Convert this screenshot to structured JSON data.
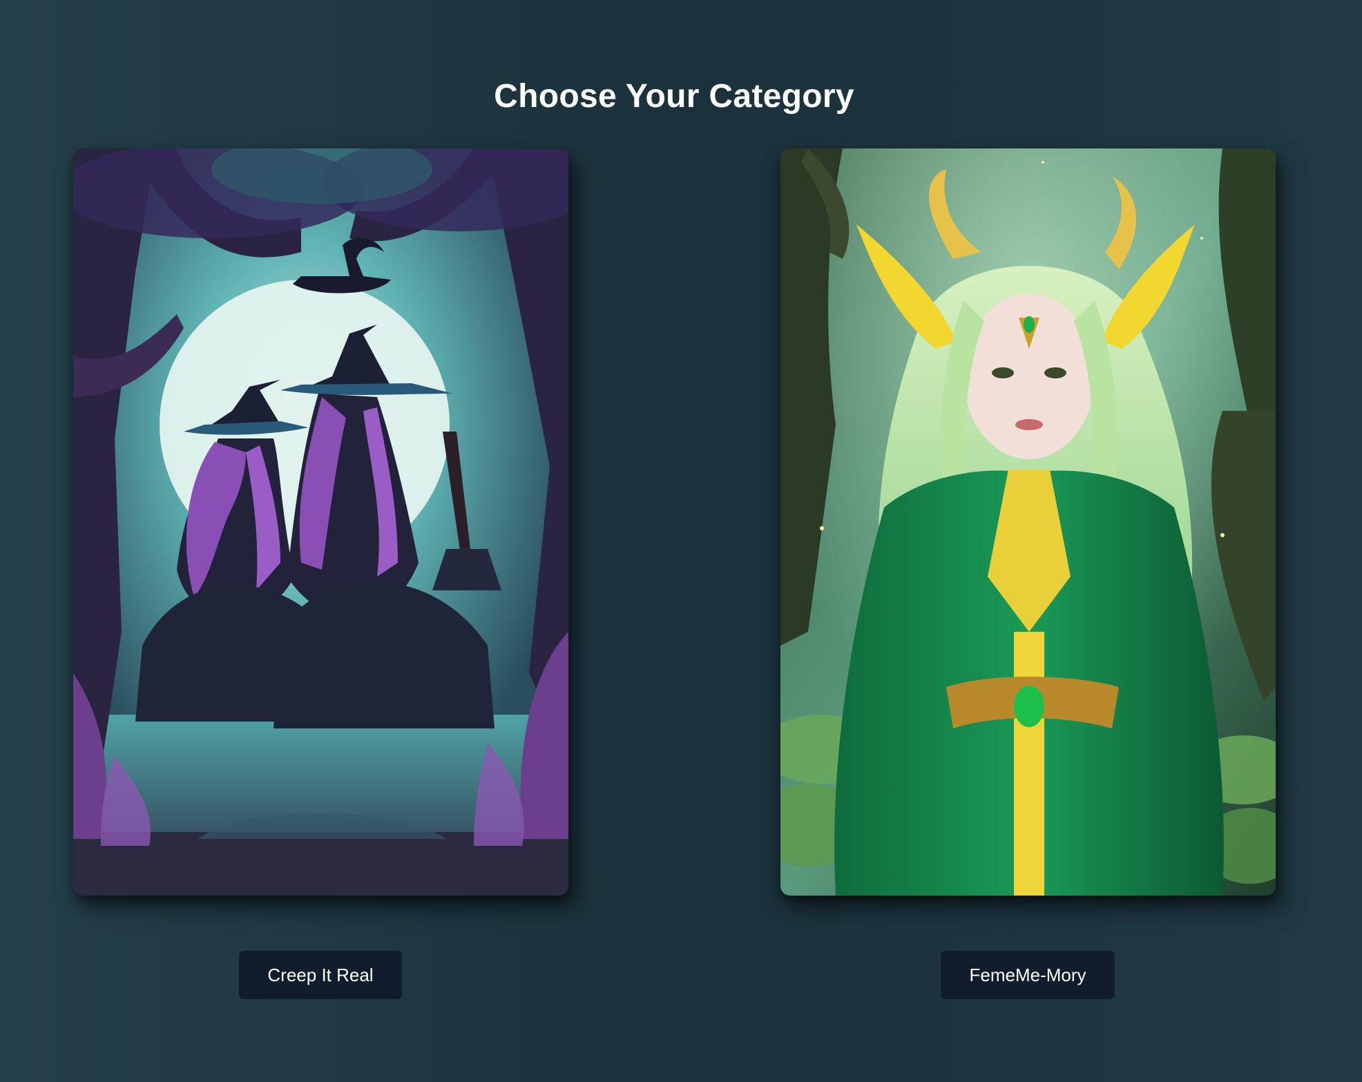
{
  "header": {
    "title": "Choose Your Category"
  },
  "categories": [
    {
      "label": "Creep It Real",
      "image": "witches-in-moonlit-forest",
      "accent": "#8a4fb5"
    },
    {
      "label": "FemeMe-Mory",
      "image": "elf-woman-in-green-forest",
      "accent": "#1f9a5a"
    }
  ],
  "colors": {
    "background": "#1f3742",
    "button_bg": "#111d2c",
    "button_text": "#ffffff",
    "title_text": "#ffffff"
  }
}
